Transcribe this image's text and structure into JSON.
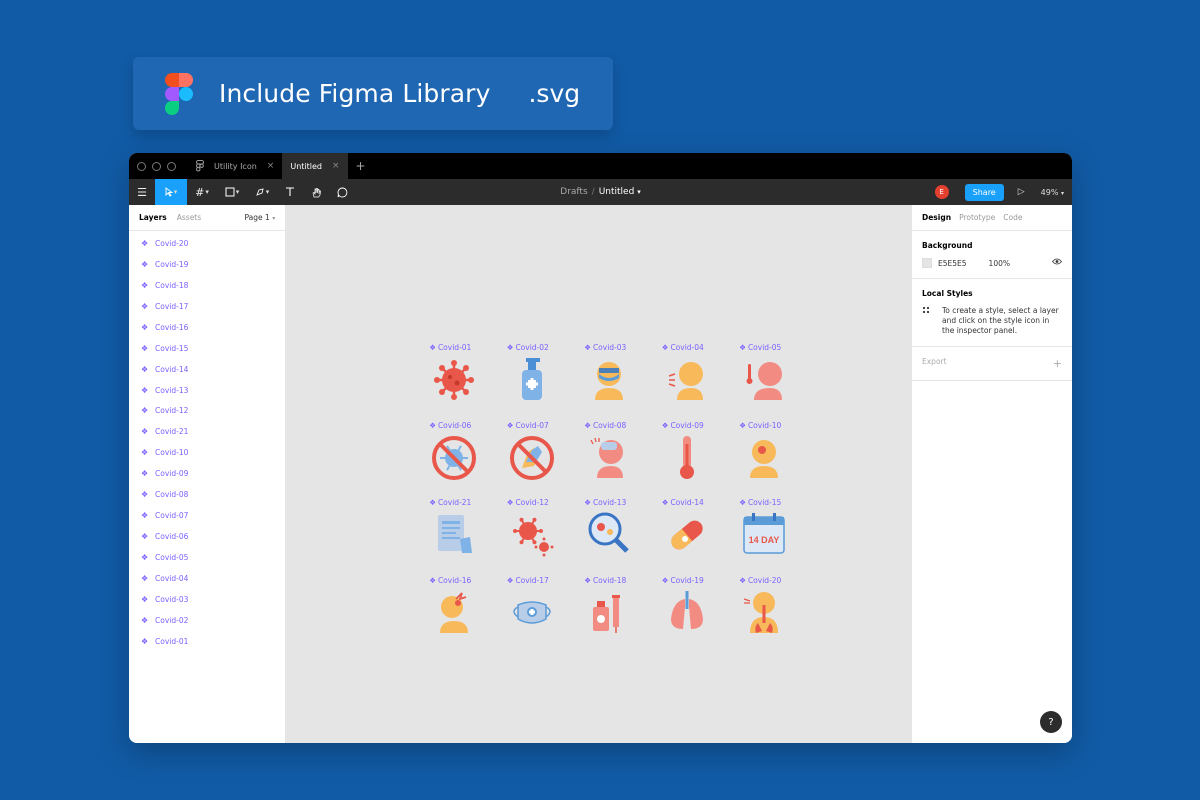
{
  "banner": {
    "title": "Include Figma Library",
    "ext": ".svg"
  },
  "tabs": [
    {
      "label": "Utility Icon",
      "active": false
    },
    {
      "label": "Untitled",
      "active": true
    }
  ],
  "toolbar": {
    "crumb_parent": "Drafts",
    "crumb_current": "Untitled",
    "avatar": "E",
    "share": "Share",
    "zoom": "49%"
  },
  "left_panel": {
    "tab_layers": "Layers",
    "tab_assets": "Assets",
    "page": "Page 1",
    "layers": [
      "Covid-20",
      "Covid-19",
      "Covid-18",
      "Covid-17",
      "Covid-16",
      "Covid-15",
      "Covid-14",
      "Covid-13",
      "Covid-12",
      "Covid-21",
      "Covid-10",
      "Covid-09",
      "Covid-08",
      "Covid-07",
      "Covid-06",
      "Covid-05",
      "Covid-04",
      "Covid-03",
      "Covid-02",
      "Covid-01"
    ]
  },
  "canvas": {
    "background": "#E5E5E5",
    "icons": [
      {
        "label": "Covid-01",
        "icon": "virus-icon"
      },
      {
        "label": "Covid-02",
        "icon": "sanitizer-icon"
      },
      {
        "label": "Covid-03",
        "icon": "masked-person-icon"
      },
      {
        "label": "Covid-04",
        "icon": "cough-person-icon"
      },
      {
        "label": "Covid-05",
        "icon": "fever-person-icon"
      },
      {
        "label": "Covid-06",
        "icon": "no-virus-icon"
      },
      {
        "label": "Covid-07",
        "icon": "no-handshake-icon"
      },
      {
        "label": "Covid-08",
        "icon": "headache-icon"
      },
      {
        "label": "Covid-09",
        "icon": "thermometer-icon"
      },
      {
        "label": "Covid-10",
        "icon": "infected-head-icon"
      },
      {
        "label": "Covid-21",
        "icon": "report-icon"
      },
      {
        "label": "Covid-12",
        "icon": "virus-cluster-icon"
      },
      {
        "label": "Covid-13",
        "icon": "magnifier-virus-icon"
      },
      {
        "label": "Covid-14",
        "icon": "pill-icon"
      },
      {
        "label": "Covid-15",
        "icon": "calendar-14-day-icon"
      },
      {
        "label": "Covid-16",
        "icon": "pain-person-icon"
      },
      {
        "label": "Covid-17",
        "icon": "face-mask-icon"
      },
      {
        "label": "Covid-18",
        "icon": "vaccine-icon"
      },
      {
        "label": "Covid-19",
        "icon": "lungs-icon"
      },
      {
        "label": "Covid-20",
        "icon": "respiratory-icon"
      }
    ],
    "calendar_text": "14 DAY"
  },
  "right_panel": {
    "tab_design": "Design",
    "tab_prototype": "Prototype",
    "tab_code": "Code",
    "background_title": "Background",
    "bg_hex": "E5E5E5",
    "bg_opacity": "100%",
    "local_styles_title": "Local Styles",
    "local_styles_text": "To create a style, select a layer and click on the style icon in the inspector panel.",
    "export_title": "Export"
  },
  "help": "?"
}
